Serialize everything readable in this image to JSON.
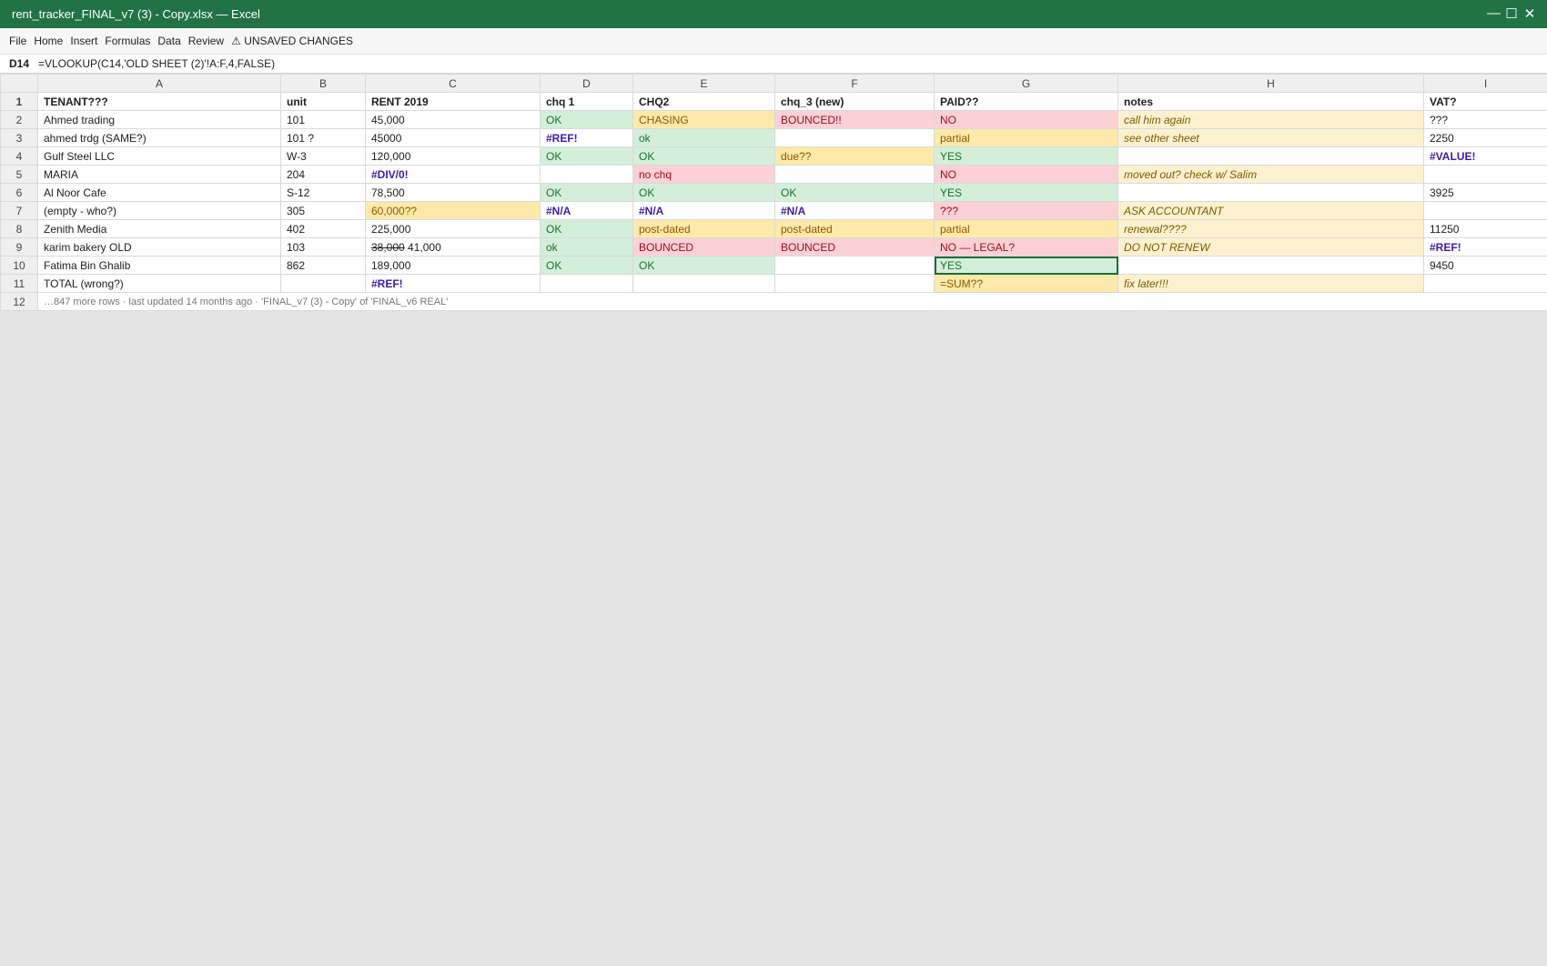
{
  "window": {
    "title": "rent_tracker_FINAL_v7 (3) - Copy.xlsx — Excel",
    "minimize": "—",
    "maximize": "☐",
    "close": "✕"
  },
  "menu": {
    "items": [
      "File",
      "Home",
      "Insert",
      "Formulas",
      "Data",
      "Review"
    ],
    "unsaved": "⚠ UNSAVED CHANGES"
  },
  "formula_bar": {
    "cell_ref": "D14",
    "formula": "=VLOOKUP(C14,'OLD SHEET (2)'!A:F,4,FALSE)"
  },
  "columns": [
    "A",
    "B",
    "C",
    "D",
    "E",
    "F",
    "G",
    "H",
    "I"
  ],
  "colors": {
    "title_bar": "#217346",
    "ok_fill": "#d3efd9",
    "warn_fill": "#fde9a9",
    "bad_fill": "#fbd1d6",
    "error_text": "#3d1aa8"
  },
  "rows": [
    {
      "n": "1",
      "cells": [
        "TENANT???",
        "unit",
        "RENT 2019",
        "chq 1",
        "CHQ2",
        "chq_3 (new)",
        "PAID??",
        "notes",
        "VAT?"
      ]
    },
    {
      "n": "2",
      "cells": [
        "Ahmed trading",
        "101",
        "45,000",
        "OK",
        "CHASING",
        "BOUNCED!!",
        "NO",
        "call him again",
        "???"
      ]
    },
    {
      "n": "3",
      "cells": [
        "ahmed trdg (SAME?)",
        "101 ?",
        "45000",
        "#REF!",
        "ok",
        "",
        "partial",
        "see other sheet",
        "2250"
      ]
    },
    {
      "n": "4",
      "cells": [
        "Gulf Steel LLC",
        "W-3",
        "120,000",
        "OK",
        "OK",
        "due??",
        "YES",
        "",
        "#VALUE!"
      ]
    },
    {
      "n": "5",
      "cells": [
        "MARIA",
        "204",
        "#DIV/0!",
        "",
        "no chq",
        "",
        "NO",
        "moved out? check w/ Salim",
        ""
      ]
    },
    {
      "n": "6",
      "cells": [
        "Al Noor Cafe",
        "S-12",
        "78,500",
        "OK",
        "OK",
        "OK",
        "YES",
        "",
        "3925"
      ]
    },
    {
      "n": "7",
      "cells": [
        "(empty - who?)",
        "305",
        "60,000??",
        "#N/A",
        "#N/A",
        "#N/A",
        "???",
        "ASK ACCOUNTANT",
        ""
      ]
    },
    {
      "n": "8",
      "cells": [
        "Zenith Media",
        "402",
        "225,000",
        "OK",
        "post-dated",
        "post-dated",
        "partial",
        "renewal????",
        "11250"
      ]
    },
    {
      "n": "9",
      "cells": [
        "karim bakery OLD",
        "103",
        "",
        "ok",
        "BOUNCED",
        "BOUNCED",
        "NO — LEGAL?",
        "DO NOT RENEW",
        "#REF!"
      ],
      "rent_old": "38,000",
      "rent_new": "41,000"
    },
    {
      "n": "10",
      "cells": [
        "Fatima Bin Ghalib",
        "862",
        "189,000",
        "OK",
        "OK",
        "",
        "YES",
        "",
        "9450"
      ]
    },
    {
      "n": "11",
      "cells": [
        "TOTAL (wrong?)",
        "",
        "#REF!",
        "",
        "",
        "",
        "=SUM??",
        "fix later!!!",
        ""
      ]
    }
  ],
  "footer_row": {
    "n": "12",
    "text": "…847 more rows · last updated 14 months ago · 'FINAL_v7 (3) - Copy' of 'FINAL_v6 REAL'"
  }
}
